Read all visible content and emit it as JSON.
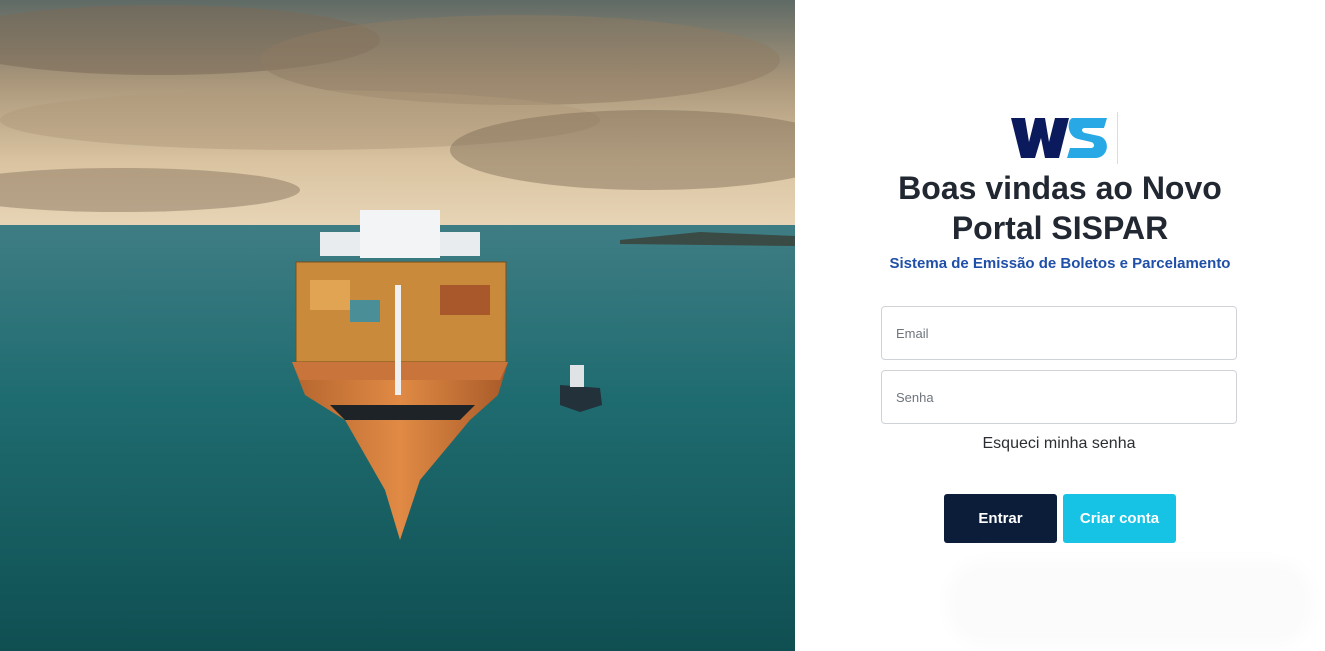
{
  "hero": {
    "image": "cargo-ship-at-sea-photo"
  },
  "brand": {
    "logo_icon": "ws-logo-icon",
    "dark_color": "#0a1a5c",
    "light_color": "#29a8e6"
  },
  "login": {
    "title_line1": "Boas vindas ao Novo",
    "title_line2": "Portal SISPAR",
    "subtitle": "Sistema de Emissão de Boletos e Parcelamento",
    "email_placeholder": "Email",
    "password_placeholder": "Senha",
    "forgot_label": "Esqueci minha senha",
    "enter_label": "Entrar",
    "create_label": "Criar conta"
  },
  "colors": {
    "primary": "#0c1d3a",
    "accent": "#17c3e4",
    "subtitle": "#1f4fa8"
  }
}
